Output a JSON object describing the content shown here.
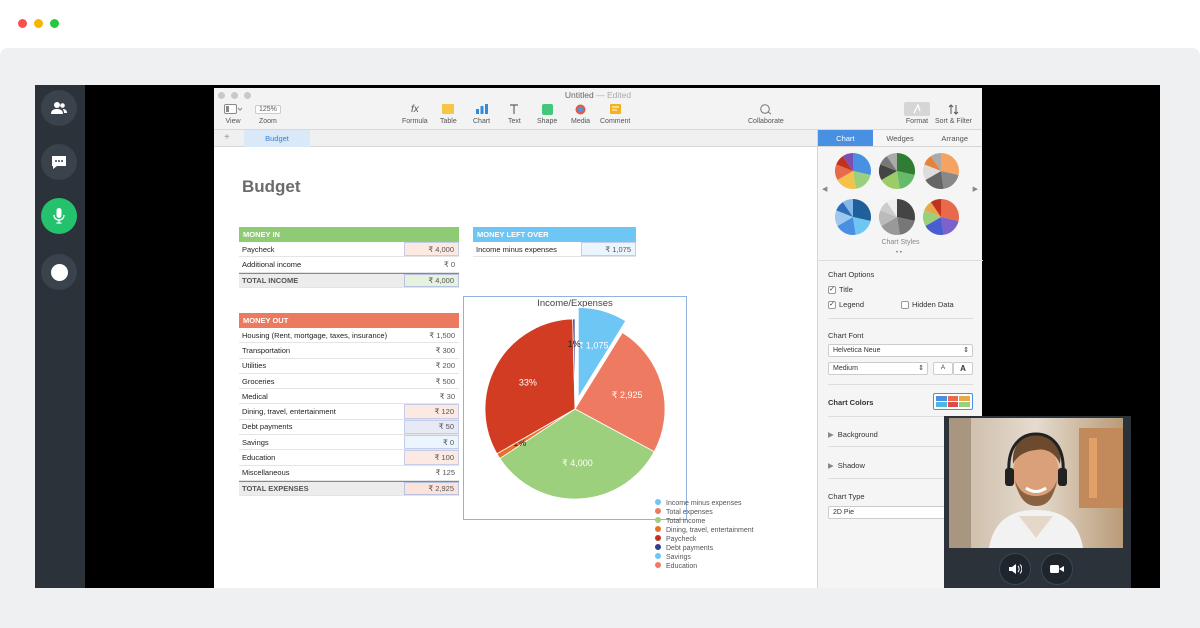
{
  "window": {
    "title": "Untitled",
    "edited": " — Edited"
  },
  "toolbar": [
    {
      "label": "View",
      "icon": "sidebar-icon"
    },
    {
      "label": "Zoom",
      "value": "125%"
    },
    {
      "label": "Formula",
      "icon": "function-icon"
    },
    {
      "label": "Table",
      "icon": "table-icon"
    },
    {
      "label": "Chart",
      "icon": "chart-icon"
    },
    {
      "label": "Text",
      "icon": "text-icon"
    },
    {
      "label": "Shape",
      "icon": "shape-icon"
    },
    {
      "label": "Media",
      "icon": "media-icon"
    },
    {
      "label": "Comment",
      "icon": "comment-icon"
    },
    {
      "label": "Collaborate",
      "icon": "collaborate-icon"
    },
    {
      "label": "Format",
      "icon": "format-icon"
    },
    {
      "label": "Sort & Filter",
      "icon": "sort-icon"
    }
  ],
  "sheet_tab": "Budget",
  "add_sheet": "+",
  "budget_title": "Budget",
  "money_in": {
    "header": "MONEY IN",
    "rows": [
      {
        "label": "Paycheck",
        "value": "₹ 4,000"
      },
      {
        "label": "Additional income",
        "value": "₹ 0"
      }
    ],
    "total": {
      "label": "TOTAL INCOME",
      "value": "₹ 4,000"
    }
  },
  "money_left": {
    "header": "MONEY LEFT OVER",
    "row": {
      "label": "Income minus expenses",
      "value": "₹ 1,075"
    }
  },
  "money_out": {
    "header": "MONEY OUT",
    "rows": [
      {
        "label": "Housing (Rent, mortgage, taxes, insurance)",
        "value": "₹ 1,500"
      },
      {
        "label": "Transportation",
        "value": "₹ 300"
      },
      {
        "label": "Utilities",
        "value": "₹ 200"
      },
      {
        "label": "Groceries",
        "value": "₹ 500"
      },
      {
        "label": "Medical",
        "value": "₹ 30"
      },
      {
        "label": "Dining, travel, entertainment",
        "value": "₹ 120"
      },
      {
        "label": "Debt payments",
        "value": "₹ 50"
      },
      {
        "label": "Savings",
        "value": "₹ 0"
      },
      {
        "label": "Education",
        "value": "₹ 100"
      },
      {
        "label": "Miscellaneous",
        "value": "₹ 125"
      }
    ],
    "total": {
      "label": "TOTAL EXPENSES",
      "value": "₹ 2,925"
    }
  },
  "chart_data": {
    "type": "pie",
    "title": "Income/Expenses",
    "slices": [
      {
        "name": "Income minus expenses",
        "value": 1075,
        "label": "₹ 1,075",
        "color": "#6ec6f5",
        "exploded": true
      },
      {
        "name": "Total expenses",
        "value": 2925,
        "label": "₹ 2,925",
        "color": "#ee7a61"
      },
      {
        "name": "Total income",
        "value": 4000,
        "label": "₹ 4,000",
        "color": "#9cd07c"
      },
      {
        "name": "Dining, travel, entertainment",
        "value": 120,
        "label": "1%",
        "color": "#e8702a"
      },
      {
        "name": "Paycheck",
        "value": 4000,
        "label": "33%",
        "color": "#d23c22"
      },
      {
        "name": "Debt payments",
        "value": 50,
        "label": "1%",
        "color": "#363c8e"
      }
    ],
    "legend": [
      "Income minus expenses",
      "Total expenses",
      "Total income",
      "Dining, travel, entertainment",
      "Paycheck",
      "Debt payments",
      "Savings",
      "Education"
    ],
    "legend_colors": [
      "#6ec6f5",
      "#ee7a61",
      "#9cd07c",
      "#e8702a",
      "#c0321f",
      "#363c8e",
      "#6ec6f5",
      "#ee7a61"
    ],
    "legend_position": "bottom-right"
  },
  "sidebar": {
    "tabs": [
      "Chart",
      "Wedges",
      "Arrange"
    ],
    "styles_label": "Chart Styles",
    "chart_options": "Chart Options",
    "title_check": "Title",
    "legend_check": "Legend",
    "hidden_data_check": "Hidden Data",
    "chart_font": "Chart Font",
    "font_name": "Helvetica Neue",
    "font_weight": "Medium",
    "font_small": "A",
    "font_large": "A",
    "chart_colors": "Chart Colors",
    "background": "Background",
    "shadow": "Shadow",
    "chart_type": "Chart Type",
    "chart_type_value": "2D Pie"
  },
  "call_controls": [
    "people-icon",
    "chat-icon",
    "microphone-icon",
    "record-icon"
  ],
  "video_controls": [
    "speaker-icon",
    "camera-icon"
  ]
}
